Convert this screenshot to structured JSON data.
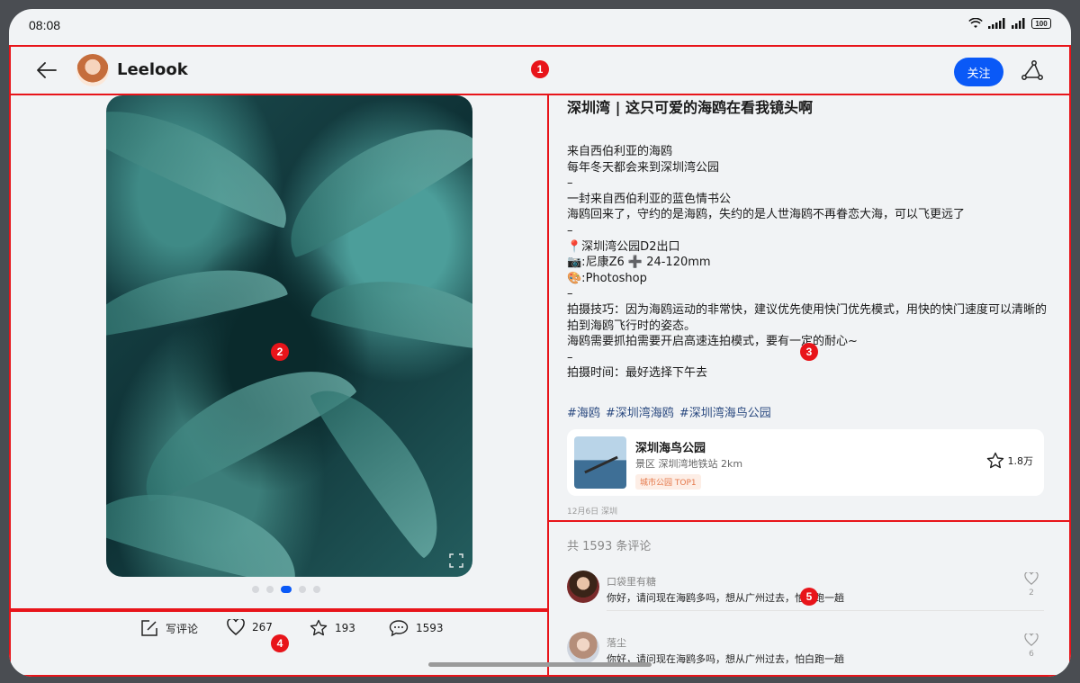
{
  "status": {
    "time": "08:08",
    "battery": "100"
  },
  "header": {
    "username": "Leelook",
    "follow_label": "关注"
  },
  "markers": [
    "1",
    "2",
    "3",
    "4",
    "5"
  ],
  "image": {
    "current_index": 3,
    "total": 5
  },
  "actions": {
    "comment_label": "写评论",
    "likes": "267",
    "favorites": "193",
    "comments": "1593"
  },
  "article": {
    "title": "深圳湾 | 这只可爱的海鸥在看我镜头啊",
    "lines": [
      "来自西伯利亚的海鸥",
      "每年冬天都会来到深圳湾公园",
      "–",
      "一封来自西伯利亚的蓝色情书公",
      "海鸥回来了，守约的是海鸥，失约的是人世海鸥不再眷恋大海，可以飞更远了",
      "–",
      "📍深圳湾公园D2出口",
      "📷:尼康Z6 ➕ 24-120mm",
      "🎨:Photoshop",
      "–",
      "拍摄技巧：因为海鸥运动的非常快，建议优先使用快门优先模式，用快的快门速度可以清晰的",
      "拍到海鸥飞行时的姿态。",
      "海鸥需要抓拍需要开启高速连拍模式，要有一定的耐心~",
      "–",
      "拍摄时间：最好选择下午去"
    ],
    "tags": [
      "#海鸥",
      "#深圳湾海鸥",
      "#深圳湾海鸟公园"
    ],
    "poi": {
      "name": "深圳海鸟公园",
      "subtitle": "景区 深圳湾地铁站 2km",
      "tag": "城市公园 TOP1",
      "stars": "1.8万"
    },
    "date": "12月6日 深圳"
  },
  "comments": {
    "count_label": "共 1593 条评论",
    "items": [
      {
        "name": "口袋里有糖",
        "text": "你好，请问现在海鸥多吗，想从广州过去，怕白跑一趟",
        "likes": "2"
      },
      {
        "name": "落尘",
        "text": "你好，请问现在海鸥多吗，想从广州过去，怕白跑一趟",
        "likes": "6"
      }
    ]
  }
}
